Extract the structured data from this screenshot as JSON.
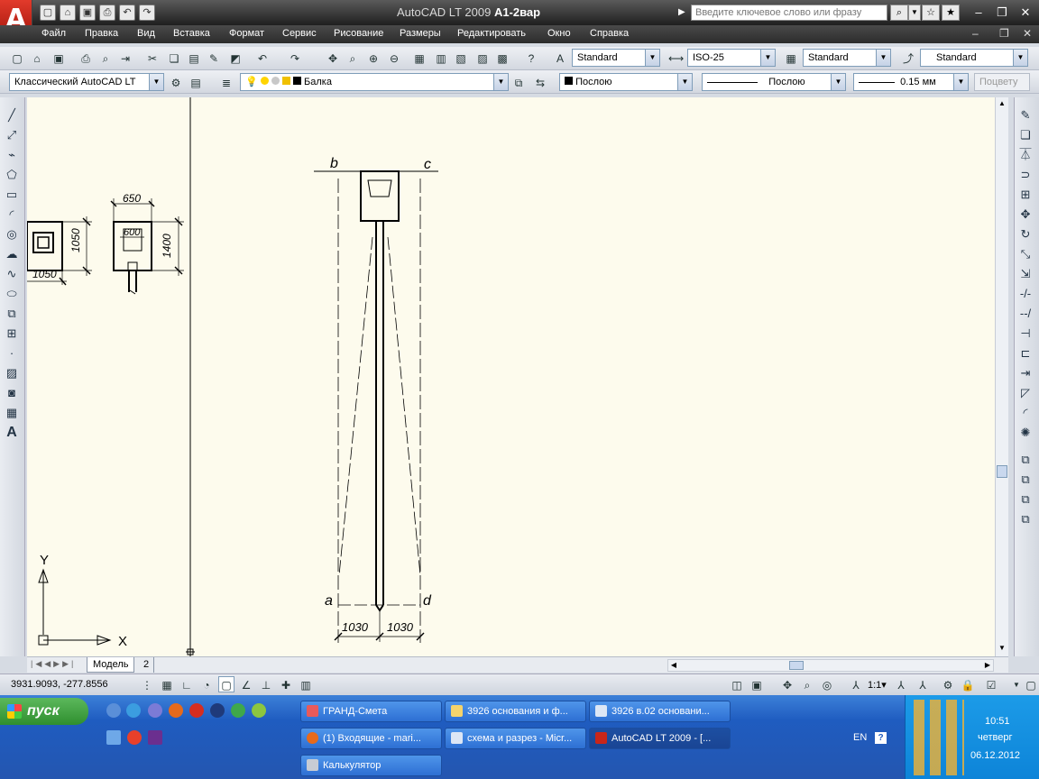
{
  "window": {
    "app": "AutoCAD LT 2009",
    "document": "A1-2вар"
  },
  "search": {
    "placeholder": "Введите ключевое слово или фразу"
  },
  "menu": [
    "Файл",
    "Правка",
    "Вид",
    "Вставка",
    "Формат",
    "Сервис",
    "Рисование",
    "Размеры",
    "Редактировать",
    "Окно",
    "Справка"
  ],
  "styles": {
    "text_style": "Standard",
    "dim_style": "ISO-25",
    "table_style": "Standard",
    "multileader_style": "Standard"
  },
  "workspace": "Классический AutoCAD LT",
  "layer": "Балка",
  "properties": {
    "color": "Послою",
    "linetype": "Послою",
    "lineweight": "0.15 мм",
    "plot_style": "Поцвету"
  },
  "drawing": {
    "left_dim": "1050",
    "left_dim_bottom": "1050",
    "section_width": "650",
    "section_inner": "600",
    "section_height": "1400",
    "pile_labels": {
      "a": "a",
      "b": "b",
      "c": "c",
      "d": "d"
    },
    "bottom_dim_left": "1030",
    "bottom_dim_right": "1030",
    "ucs_x": "X",
    "ucs_y": "Y"
  },
  "tabs": {
    "model": "Модель",
    "layout": "2"
  },
  "status": {
    "coords": "3931.9093, -277.8556"
  },
  "taskbar": {
    "start": "пуск",
    "tasks": [
      {
        "label": "ГРАНД-Смета"
      },
      {
        "label": "3926 основания и ф..."
      },
      {
        "label": "3926 в.02 основани..."
      },
      {
        "label": "(1) Входящие - mari..."
      },
      {
        "label": "схема и разрез - Micr..."
      },
      {
        "label": "AutoCAD LT 2009 - [..."
      },
      {
        "label": "Калькулятор"
      }
    ],
    "lang": "EN",
    "time": "10:51",
    "day": "четверг",
    "date": "06.12.2012"
  }
}
